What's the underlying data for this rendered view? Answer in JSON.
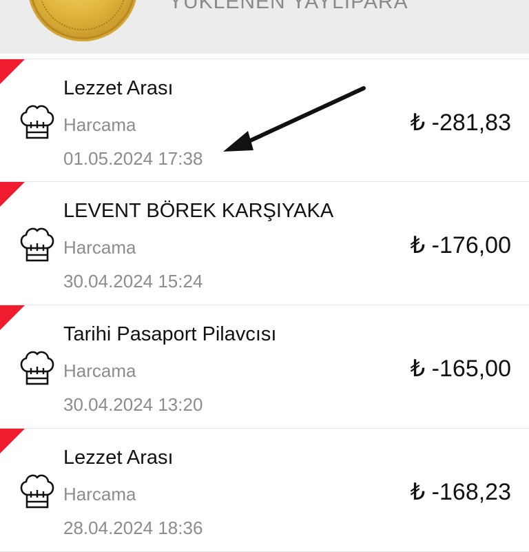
{
  "header": {
    "title": "YÜKLENEN YAYLIPARA"
  },
  "transactions": [
    {
      "merchant": "Lezzet Arası",
      "type": "Harcama",
      "datetime": "01.05.2024 17:38",
      "amount": "₺ -281,83",
      "icon": "chef-hat-icon"
    },
    {
      "merchant": "LEVENT BÖREK KARŞIYAKA",
      "type": "Harcama",
      "datetime": "30.04.2024 15:24",
      "amount": "₺ -176,00",
      "icon": "chef-hat-icon"
    },
    {
      "merchant": "Tarihi Pasaport Pilavcısı",
      "type": "Harcama",
      "datetime": "30.04.2024 13:20",
      "amount": "₺ -165,00",
      "icon": "chef-hat-icon"
    },
    {
      "merchant": "Lezzet Arası",
      "type": "Harcama",
      "datetime": "28.04.2024 18:36",
      "amount": "₺ -168,23",
      "icon": "chef-hat-icon"
    }
  ],
  "colors": {
    "corner_marker": "#ee1c2e",
    "header_bg": "#ececec",
    "secondary_text": "#8c8c8c"
  }
}
